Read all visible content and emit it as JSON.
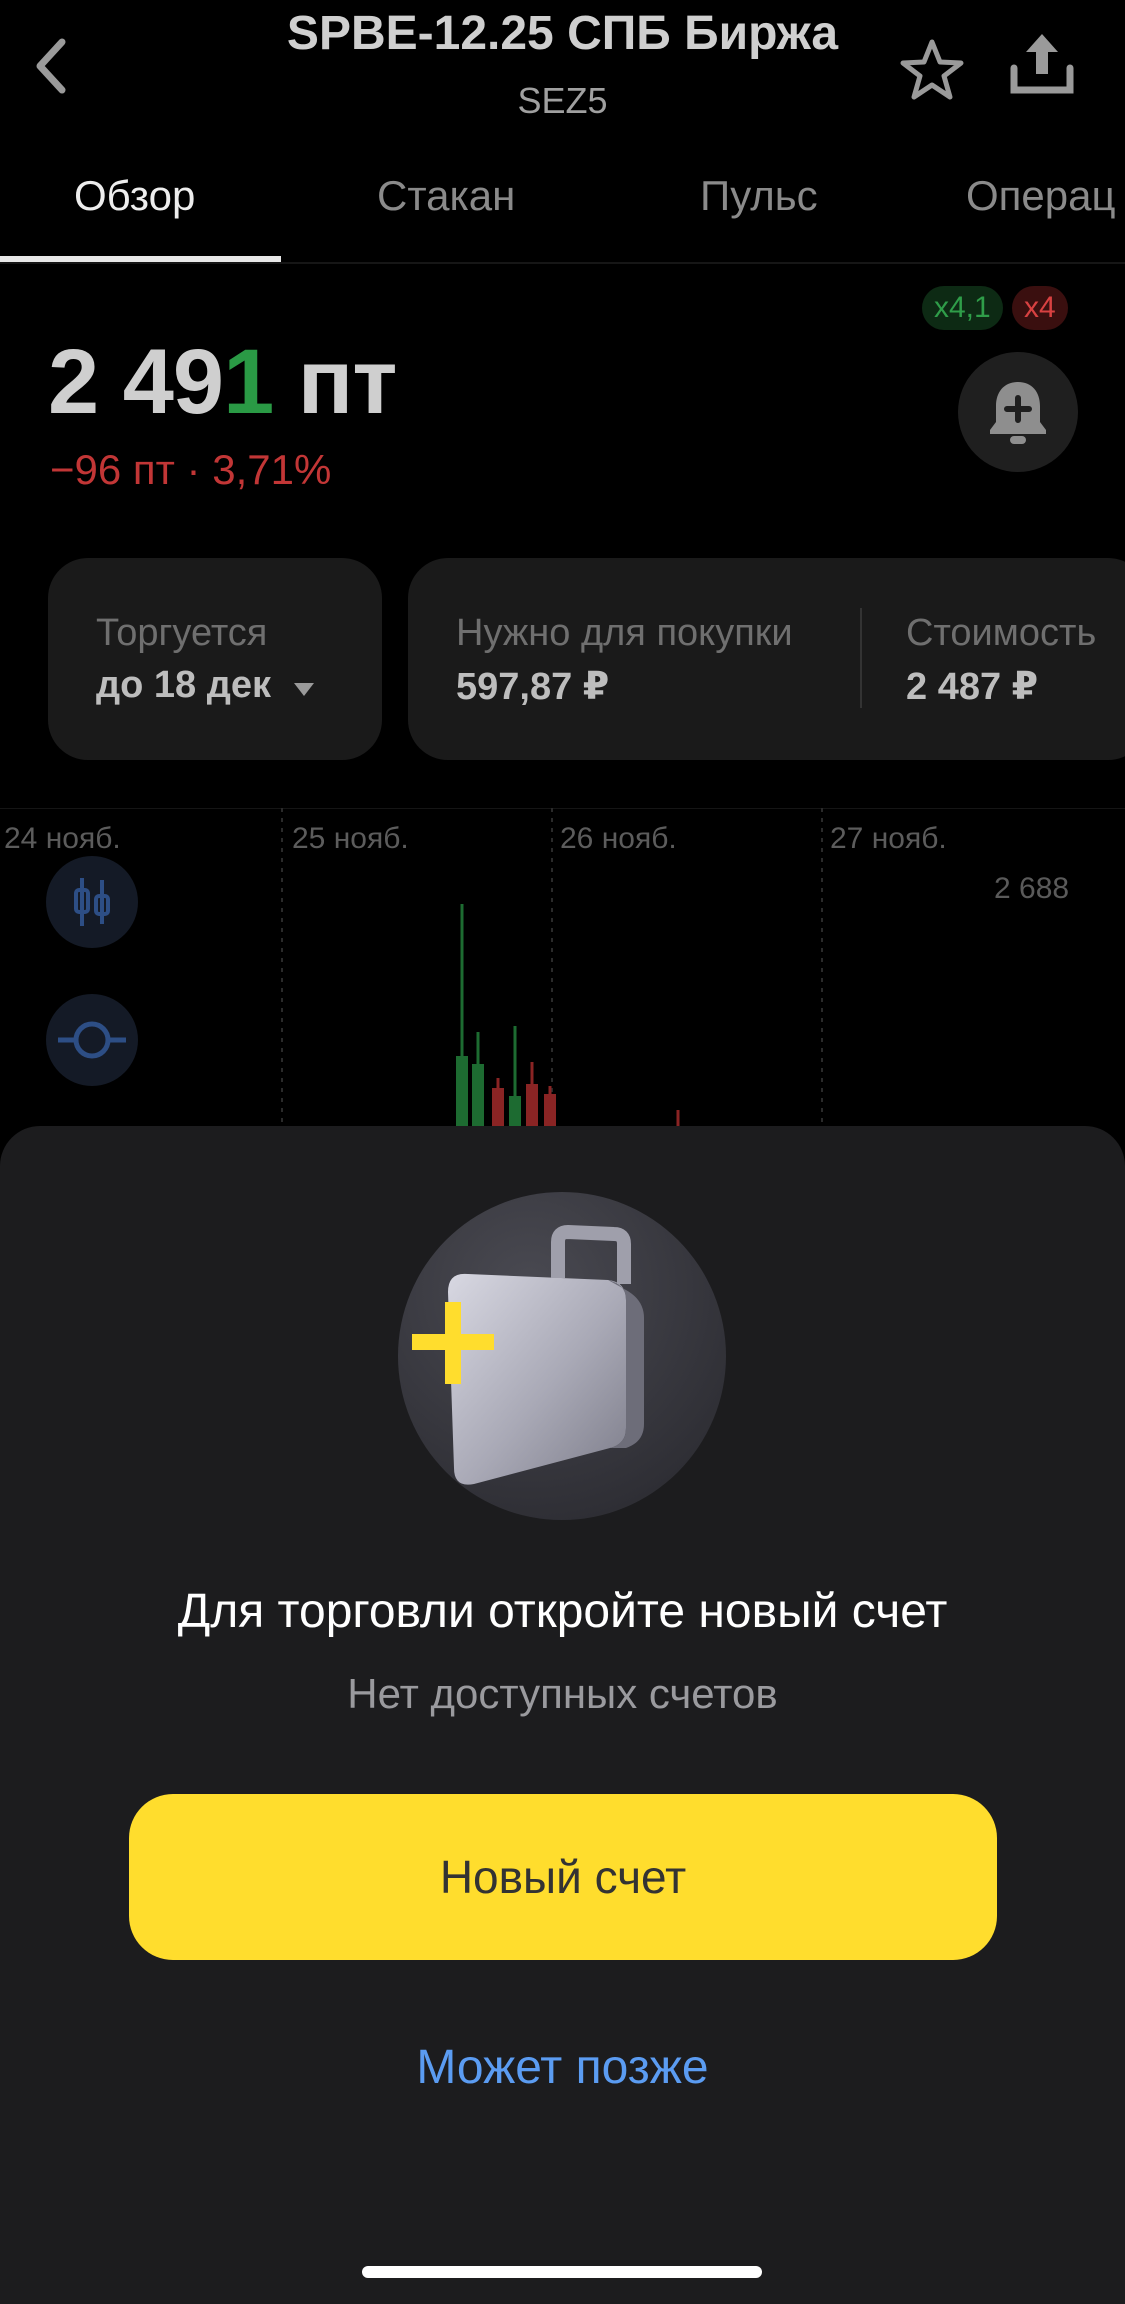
{
  "header": {
    "title": "SPBE-12.25 СПБ Биржа",
    "ticker": "SEZ5",
    "back_icon": "chevron-left-icon",
    "favorite_icon": "star-icon",
    "share_icon": "share-icon"
  },
  "tabs": [
    {
      "label": "Обзор",
      "active": true
    },
    {
      "label": "Стакан",
      "active": false
    },
    {
      "label": "Пульс",
      "active": false
    },
    {
      "label": "Операц",
      "active": false
    }
  ],
  "leverage": {
    "long": "x4,1",
    "short": "x4"
  },
  "price": {
    "main": "2 49",
    "last_digit": "1",
    "unit": " пт",
    "change": "−96 пт · 3,71%",
    "alert_icon": "bell-plus-icon"
  },
  "info_cards": {
    "trade": {
      "label": "Торгуется",
      "value": "до 18 дек"
    },
    "buy": {
      "label": "Нужно для покупки",
      "value": "597,87 ₽"
    },
    "cost": {
      "label": "Стоимость",
      "value": "2 487 ₽"
    }
  },
  "chart": {
    "dates": [
      "24 нояб.",
      "25 нояб.",
      "26 нояб.",
      "27 нояб."
    ],
    "price_label": "2 688",
    "tool_icons": [
      "candles-icon",
      "crosshair-icon"
    ]
  },
  "sheet": {
    "title": "Для торговли откройте новый счет",
    "subtitle": "Нет доступных счетов",
    "primary_button": "Новый счет",
    "secondary_button": "Может позже",
    "illustration": "briefcase-plus-icon"
  },
  "colors": {
    "accent_yellow": "#ffdd2d",
    "link_blue": "#5b9cf2",
    "positive": "#2a9a45",
    "negative": "#c23636",
    "sheet_bg": "#1c1c1e"
  }
}
